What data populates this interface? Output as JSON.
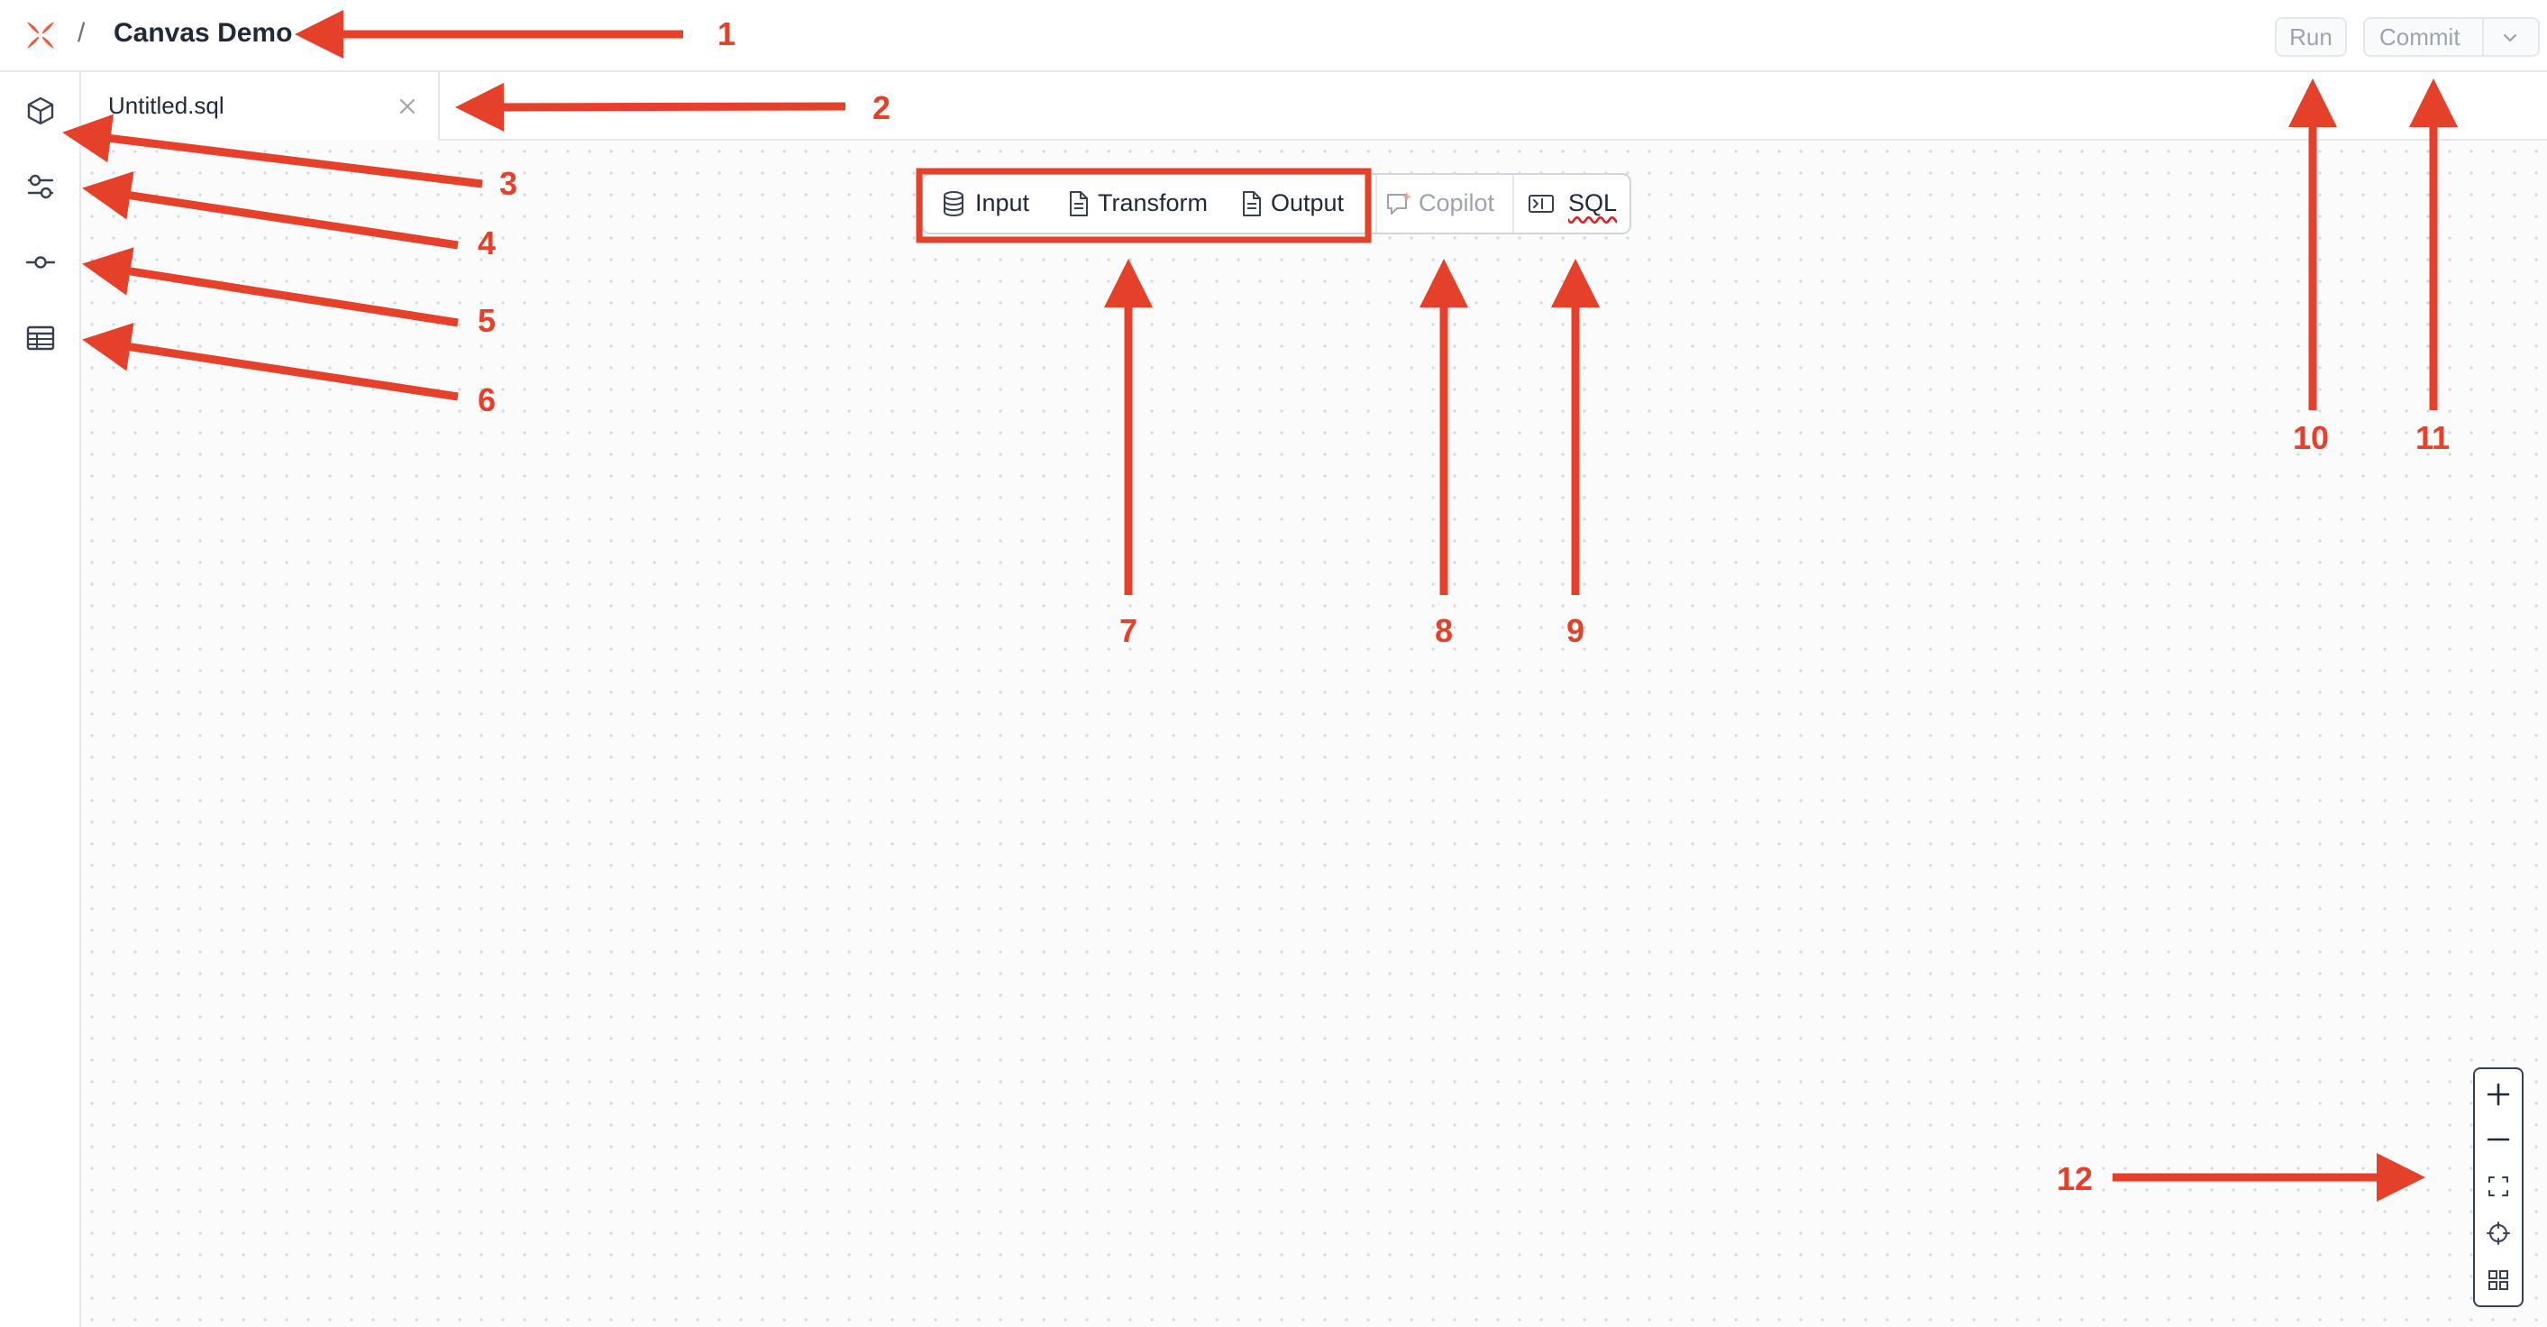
{
  "header": {
    "separator": "/",
    "title": "Canvas Demo",
    "run_label": "Run",
    "commit_label": "Commit",
    "logo_icon": "x-logo-icon"
  },
  "sidebar": {
    "items": [
      {
        "name": "cube-icon"
      },
      {
        "name": "sliders-icon"
      },
      {
        "name": "commit-node-icon"
      },
      {
        "name": "table-icon"
      }
    ]
  },
  "tabs": [
    {
      "label": "Untitled.sql",
      "close_icon": "close-icon"
    }
  ],
  "toolbar": {
    "input_label": "Input",
    "transform_label": "Transform",
    "output_label": "Output",
    "copilot_label": "Copilot",
    "sql_label": "SQL"
  },
  "zoom_controls": [
    "zoom-in",
    "zoom-out",
    "fit-view",
    "center",
    "grid"
  ],
  "annotations": [
    "1",
    "2",
    "3",
    "4",
    "5",
    "6",
    "7",
    "8",
    "9",
    "10",
    "11",
    "12"
  ],
  "colors": {
    "accent": "#e5402a",
    "border": "#e5e7eb",
    "disabled_text": "#9ca3af",
    "canvas_bg": "#fbfbfc"
  }
}
